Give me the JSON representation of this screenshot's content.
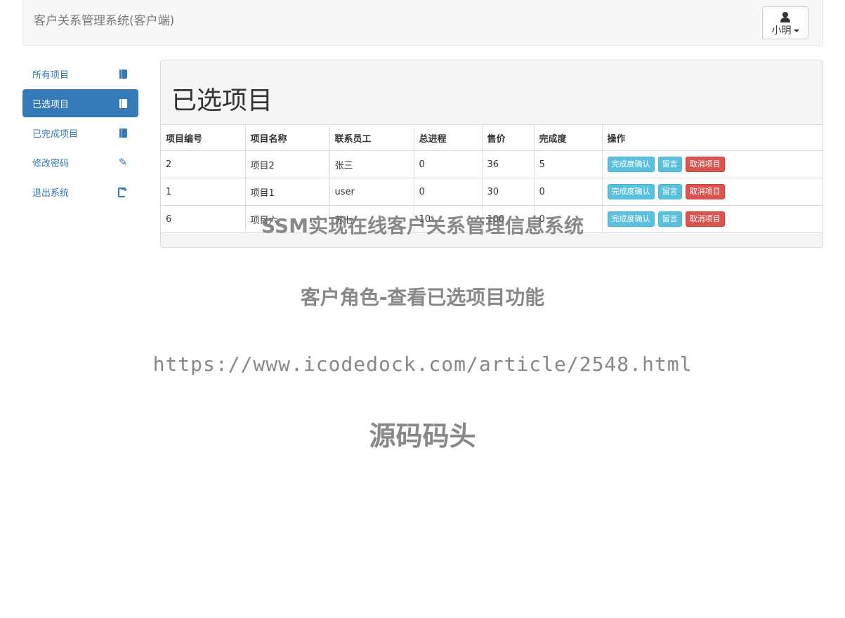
{
  "navbar": {
    "brand": "客户关系管理系统(客户端)",
    "user": "小明"
  },
  "sidebar": {
    "items": [
      {
        "label": "所有项目",
        "icon": "book-icon",
        "active": false
      },
      {
        "label": "已选项目",
        "icon": "book-icon",
        "active": true
      },
      {
        "label": "已完成项目",
        "icon": "book-icon",
        "active": false
      },
      {
        "label": "修改密码",
        "icon": "pencil-icon",
        "active": false
      },
      {
        "label": "退出系统",
        "icon": "logout-icon",
        "active": false
      }
    ]
  },
  "main": {
    "title": "已选项目",
    "columns": [
      "项目编号",
      "项目名称",
      "联系员工",
      "总进程",
      "售价",
      "完成度",
      "操作"
    ],
    "rows": [
      {
        "id": "2",
        "name": "项目2",
        "staff": "张三",
        "progress": "0",
        "price": "36",
        "completion": "5"
      },
      {
        "id": "1",
        "name": "项目1",
        "staff": "user",
        "progress": "0",
        "price": "30",
        "completion": "0"
      },
      {
        "id": "6",
        "name": "项目六",
        "staff": "苏七",
        "progress": "10",
        "price": "100",
        "completion": "0"
      }
    ],
    "actions": {
      "confirm": "完成度确认",
      "message": "留言",
      "cancel": "取消项目"
    }
  },
  "watermark": {
    "line1": "SSM实现在线客户关系管理信息系统",
    "line2": "客户角色-查看已选项目功能",
    "line3": "https://www.icodedock.com/article/2548.html",
    "line4": "源码码头"
  }
}
